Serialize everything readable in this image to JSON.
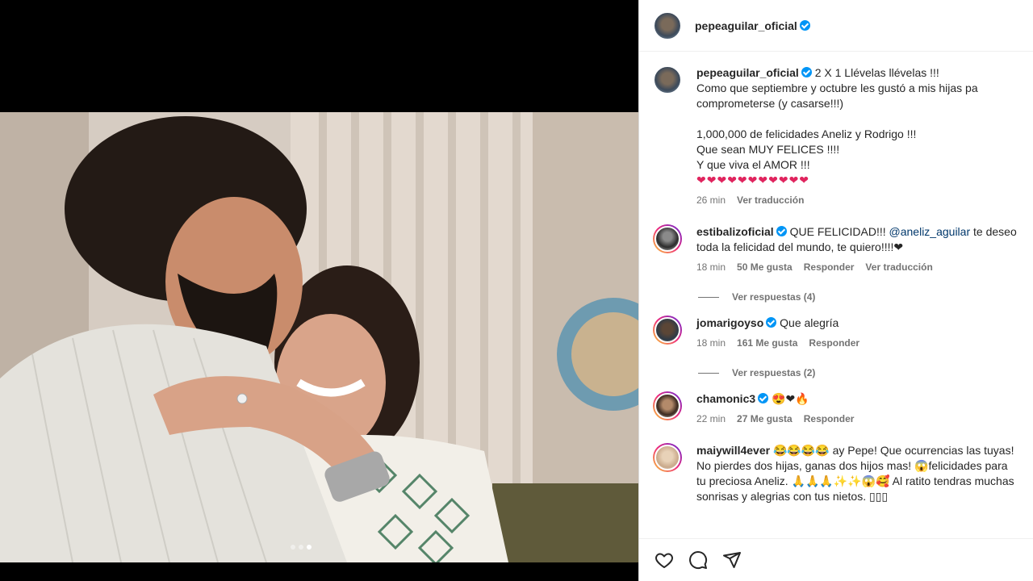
{
  "post": {
    "author": "pepeaguilar_oficial",
    "caption": {
      "username": "pepeaguilar_oficial",
      "text": "2 X 1 Llévelas llévelas !!!\nComo que septiembre y octubre les gustó a mis hijas pa comprometerse (y casarse!!!)\n\n1,000,000 de felicidades Aneliz y Rodrigo !!!\nQue sean MUY FELICES !!!!\nY que viva el AMOR !!!",
      "hearts": "❤❤❤❤❤❤❤❤❤❤❤",
      "time": "26 min",
      "translate": "Ver traducción"
    },
    "carousel": {
      "count": 3,
      "active_index": 2
    }
  },
  "comments": [
    {
      "username": "estibalizoficial",
      "verified": true,
      "text_before": "QUE FELICIDAD!!! ",
      "mention": "@aneliz_aguilar",
      "text_after": " te deseo toda la felicidad del mundo, te quiero!!!!❤",
      "time": "18 min",
      "likes": "50 Me gusta",
      "reply": "Responder",
      "translate": "Ver traducción",
      "replies": "Ver respuestas (4)"
    },
    {
      "username": "jomarigoyso",
      "verified": true,
      "text": "Que alegría",
      "time": "18 min",
      "likes": "161 Me gusta",
      "reply": "Responder",
      "replies": "Ver respuestas (2)"
    },
    {
      "username": "chamonic3",
      "verified": true,
      "text": "😍❤🔥",
      "time": "22 min",
      "likes": "27 Me gusta",
      "reply": "Responder"
    },
    {
      "username": "maiywill4ever",
      "verified": false,
      "text": "😂😂😂😂 ay Pepe! Que ocurrencias las tuyas! No pierdes dos hijas, ganas dos hijos mas! 😱felicidades para tu preciosa Aneliz. 🙏🙏🙏✨✨😱🥰 Al ratito tendras muchas sonrisas y alegrias con tus nietos. ▯▯▯"
    }
  ],
  "actions": {
    "like": "heart-icon",
    "comment": "comment-icon",
    "share": "share-icon"
  }
}
